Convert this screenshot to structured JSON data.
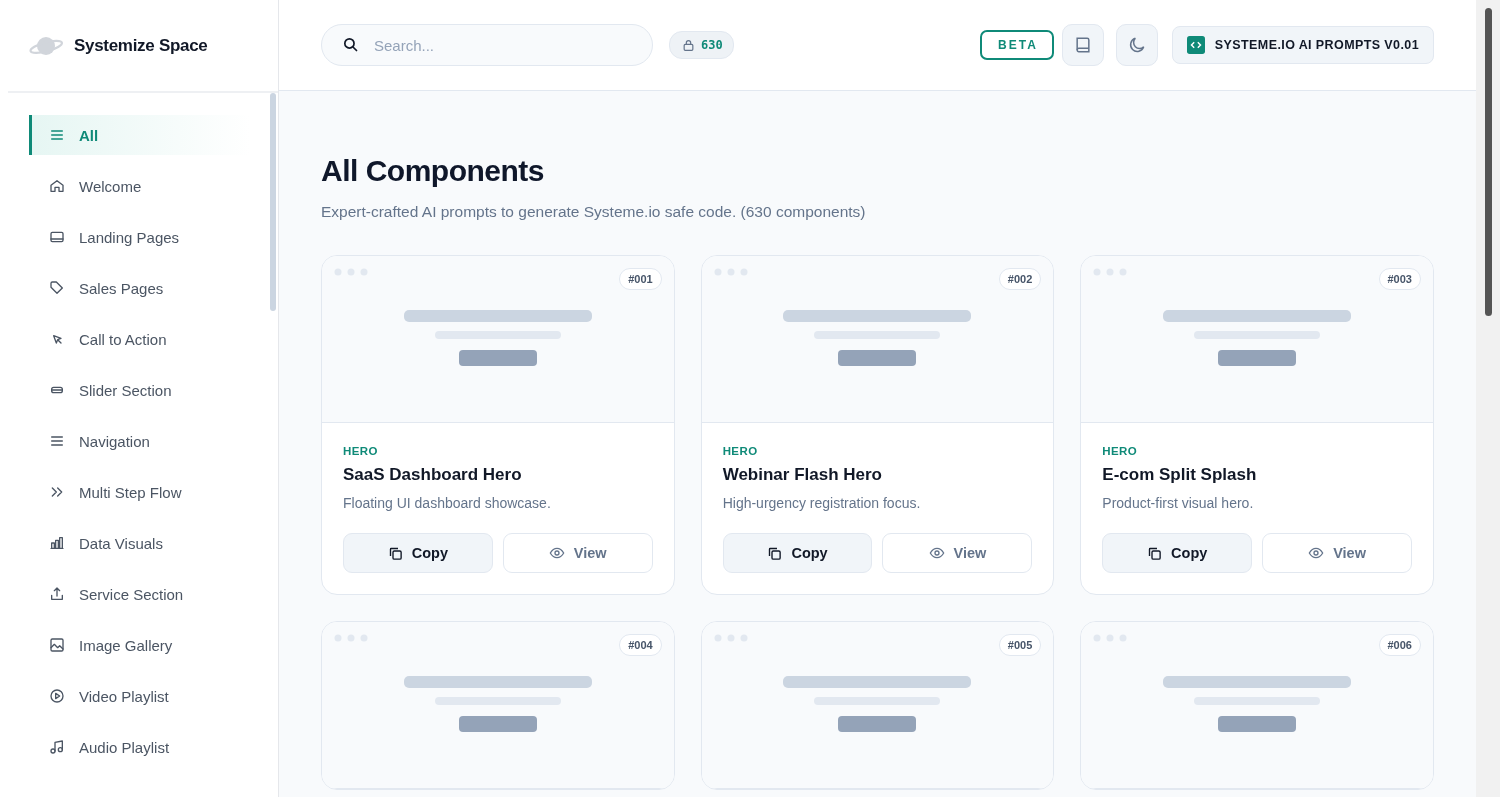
{
  "brand": {
    "name": "Systemize Space"
  },
  "sidebar": {
    "items": [
      {
        "label": "All",
        "selected": true
      },
      {
        "label": "Welcome",
        "selected": false
      },
      {
        "label": "Landing Pages",
        "selected": false
      },
      {
        "label": "Sales Pages",
        "selected": false
      },
      {
        "label": "Call to Action",
        "selected": false
      },
      {
        "label": "Slider Section",
        "selected": false
      },
      {
        "label": "Navigation",
        "selected": false
      },
      {
        "label": "Multi Step Flow",
        "selected": false
      },
      {
        "label": "Data Visuals",
        "selected": false
      },
      {
        "label": "Service Section",
        "selected": false
      },
      {
        "label": "Image Gallery",
        "selected": false
      },
      {
        "label": "Video Playlist",
        "selected": false
      },
      {
        "label": "Audio Playlist",
        "selected": false
      }
    ]
  },
  "header": {
    "search": {
      "placeholder": "Search..."
    },
    "count": "630",
    "badge": "BETA",
    "version_button": "SYSTEME.IO AI PROMPTS V0.01"
  },
  "page": {
    "title": "All Components",
    "subtitle": "Expert-crafted AI prompts to generate Systeme.io safe code. (630 components)"
  },
  "cards": [
    {
      "number": "#001",
      "tag": "HERO",
      "title": "SaaS Dashboard Hero",
      "description": "Floating UI dashboard showcase.",
      "copy": "Copy",
      "view": "View"
    },
    {
      "number": "#002",
      "tag": "HERO",
      "title": "Webinar Flash Hero",
      "description": "High-urgency registration focus.",
      "copy": "Copy",
      "view": "View"
    },
    {
      "number": "#003",
      "tag": "HERO",
      "title": "E-com Split Splash",
      "description": "Product-first visual hero.",
      "copy": "Copy",
      "view": "View"
    },
    {
      "number": "#004"
    },
    {
      "number": "#005"
    },
    {
      "number": "#006"
    }
  ]
}
